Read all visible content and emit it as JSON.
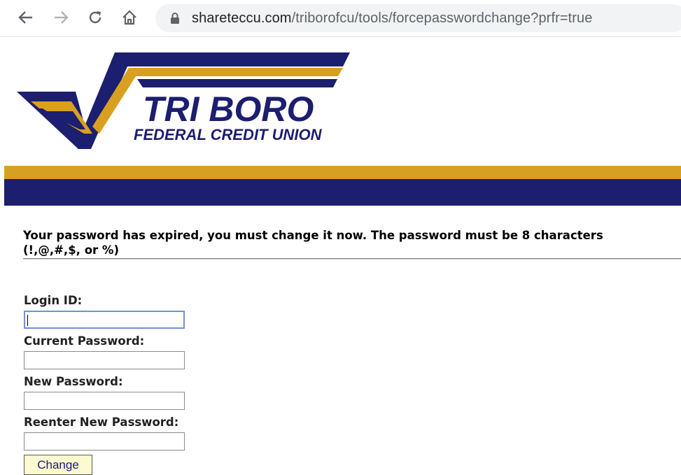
{
  "browser": {
    "url_host": "shareteccu.com",
    "url_path": "/triborofcu/tools/forcepasswordchange?prfr=true",
    "icons": [
      "back-arrow-icon",
      "forward-arrow-icon",
      "reload-icon",
      "home-icon",
      "lock-icon"
    ]
  },
  "brand": {
    "name_line1": "TRI BORO",
    "name_line2": "FEDERAL CREDIT UNION",
    "colors": {
      "navy": "#1c1e6f",
      "gold": "#d7a020"
    }
  },
  "notice": {
    "line1": "Your password has expired, you must change it now. The password must be 8 characters",
    "line2": "(!,@,#,$, or %)"
  },
  "form": {
    "login_label": "Login ID:",
    "current_label": "Current Password:",
    "new_label": "New Password:",
    "reenter_label": "Reenter New Password:",
    "submit_label": "Change"
  }
}
